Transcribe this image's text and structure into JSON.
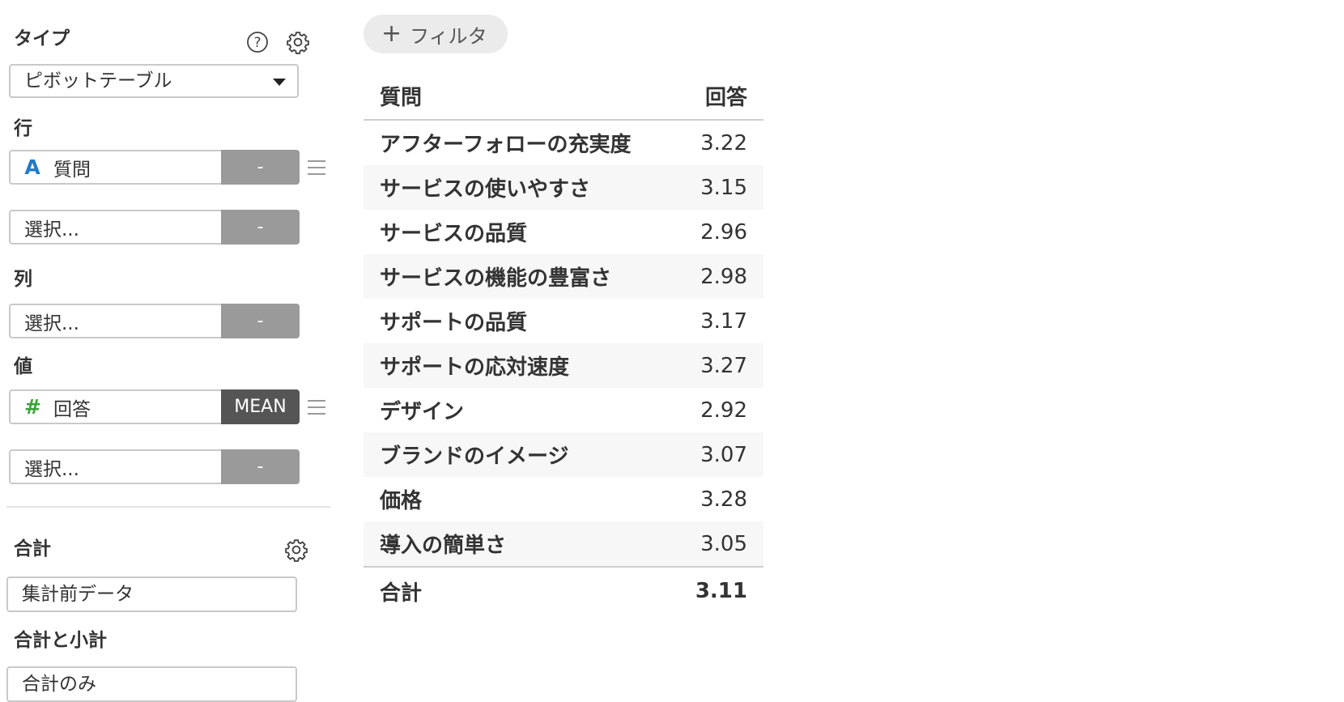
{
  "panel": {
    "type_label": "タイプ",
    "type_value": "ピボットテーブル",
    "rows_label": "行",
    "row_fields": [
      {
        "icon": "A",
        "icon_color": "#1f7bc8",
        "name": "質問",
        "agg": "-"
      },
      {
        "placeholder": "選択...",
        "agg": "-"
      }
    ],
    "cols_label": "列",
    "col_fields": [
      {
        "placeholder": "選択...",
        "agg": "-"
      }
    ],
    "values_label": "値",
    "value_fields": [
      {
        "icon": "#",
        "icon_color": "#3aa33a",
        "name": "回答",
        "agg": "MEAN"
      },
      {
        "placeholder": "選択...",
        "agg": "-"
      }
    ],
    "total_label": "合計",
    "total_value": "集計前データ",
    "subtotal_label": "合計と小計",
    "subtotal_value": "合計のみ"
  },
  "filter_button": {
    "label": "フィルタ"
  },
  "pivot": {
    "headers": [
      "質問",
      "回答"
    ],
    "rows": [
      {
        "question": "アフターフォローの充実度",
        "answer": "3.22"
      },
      {
        "question": "サービスの使いやすさ",
        "answer": "3.15"
      },
      {
        "question": "サービスの品質",
        "answer": "2.96"
      },
      {
        "question": "サービスの機能の豊富さ",
        "answer": "2.98"
      },
      {
        "question": "サポートの品質",
        "answer": "3.17"
      },
      {
        "question": "サポートの応対速度",
        "answer": "3.27"
      },
      {
        "question": "デザイン",
        "answer": "2.92"
      },
      {
        "question": "ブランドのイメージ",
        "answer": "3.07"
      },
      {
        "question": "価格",
        "answer": "3.28"
      },
      {
        "question": "導入の簡単さ",
        "answer": "3.05"
      }
    ],
    "total_label": "合計",
    "total_value": "3.11"
  }
}
